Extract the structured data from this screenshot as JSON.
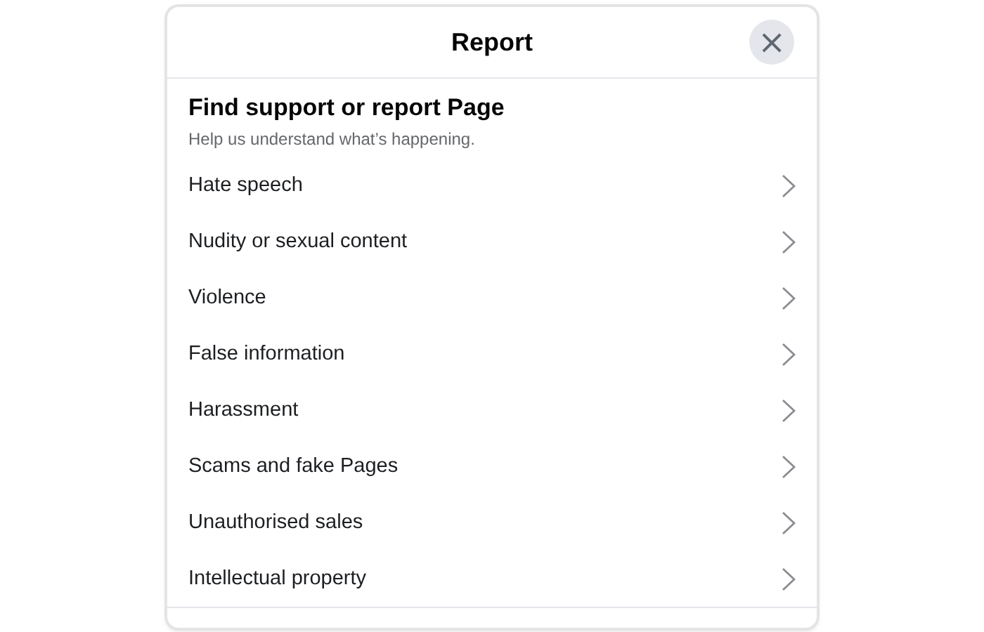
{
  "dialog": {
    "title": "Report",
    "close": "×"
  },
  "heading": "Find support or report Page",
  "subheading": "Help us understand what’s happening.",
  "options": [
    {
      "label": "Hate speech"
    },
    {
      "label": "Nudity or sexual content"
    },
    {
      "label": "Violence"
    },
    {
      "label": "False information"
    },
    {
      "label": "Harassment"
    },
    {
      "label": "Scams and fake Pages"
    },
    {
      "label": "Unauthorised sales"
    },
    {
      "label": "Intellectual property"
    }
  ]
}
